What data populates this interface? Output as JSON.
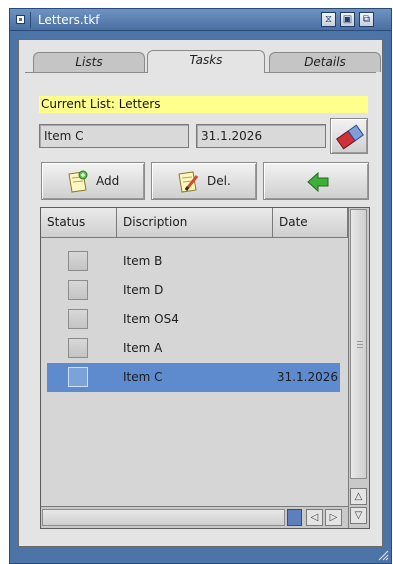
{
  "window": {
    "title": "Letters.tkf",
    "frame_color": "#4d74a6",
    "titlebar_buttons": [
      {
        "name": "iconify-button",
        "glyph": "⧖"
      },
      {
        "name": "zoom-button",
        "glyph": "▣"
      },
      {
        "name": "depth-button",
        "glyph": "⧉"
      }
    ]
  },
  "tabs": [
    {
      "label": "Lists",
      "active": false
    },
    {
      "label": "Tasks",
      "active": true
    },
    {
      "label": "Details",
      "active": false
    }
  ],
  "current_list": "Current List: Letters",
  "item_field": {
    "value": "Item C"
  },
  "date_field": {
    "value": "31.1.2026"
  },
  "buttons": {
    "add": "Add",
    "del": "Del.",
    "back_icon": "green-left-arrow"
  },
  "table": {
    "columns": [
      "Status",
      "Discription",
      "Date"
    ],
    "rows": [
      {
        "title": "Item B",
        "date": "",
        "selected": false
      },
      {
        "title": "Item D",
        "date": "",
        "selected": false
      },
      {
        "title": "Item OS4",
        "date": "",
        "selected": false
      },
      {
        "title": "Item A",
        "date": "",
        "selected": false
      },
      {
        "title": "Item C",
        "date": "31.1.2026",
        "selected": true
      }
    ],
    "selection_color": "#5d8bcd"
  },
  "highlight_color": "#ffff8c"
}
